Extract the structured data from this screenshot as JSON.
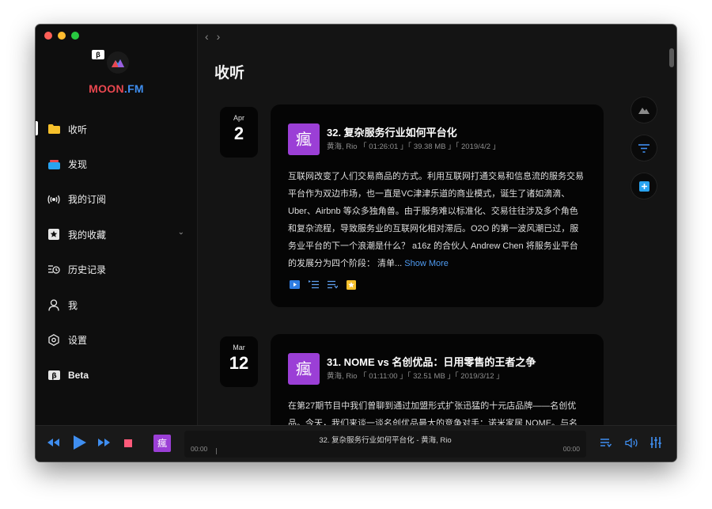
{
  "app": {
    "name_moon": "MOON",
    "name_fm": ".FM",
    "beta_badge": "β",
    "brand_red": "#e8474f",
    "brand_blue": "#3f8ef0"
  },
  "nav": {
    "items": [
      {
        "label": "收听",
        "icon": "folder-icon",
        "active": true
      },
      {
        "label": "发现",
        "icon": "discover-icon"
      },
      {
        "label": "我的订阅",
        "icon": "broadcast-icon"
      },
      {
        "label": "我的收藏",
        "icon": "star-icon"
      },
      {
        "label": "历史记录",
        "icon": "history-icon"
      },
      {
        "label": "我",
        "icon": "user-icon"
      },
      {
        "label": "设置",
        "icon": "settings-icon"
      },
      {
        "label": "Beta",
        "icon": "beta-icon"
      }
    ]
  },
  "main": {
    "title": "收听",
    "episodes": [
      {
        "month": "Apr",
        "day": "2",
        "cover_char": "瘋",
        "title": "32. 复杂服务行业如何平台化",
        "meta": "黄海, Rio 「 01:26:01 」「 39.38 MB 」「 2019/4/2 」",
        "description": "互联网改变了人们交易商品的方式。利用互联网打通交易和信息流的服务交易平台作为双边市场，也一直是VC津津乐道的商业模式，诞生了诸如滴滴、Uber、Airbnb 等众多独角兽。由于服务难以标准化、交易往往涉及多个角色和复杂流程，导致服务业的互联网化相对滞后。O2O 的第一波风潮已过，服务业平台的下一个浪潮是什么？ a16z 的合伙人 Andrew Chen 将服务业平台的发展分为四个阶段： 清单... ",
        "show_more": "Show More"
      },
      {
        "month": "Mar",
        "day": "12",
        "cover_char": "瘋",
        "title": "31. NOME vs 名创优品：日用零售的王者之争",
        "meta": "黄海, Rio 「 01:11:00 」「 32.51 MB 」「 2019/3/12 」",
        "description": "在第27期节目中我们曾聊到通过加盟形式扩张迅猛的十元店品牌——名创优品。今天，我们来谈一谈名创优品最大的竞争对手：诺米家居 NOME。与名"
      }
    ]
  },
  "player": {
    "cover_char": "瘋",
    "now_playing": "32. 复杂服务行业如何平台化 - 黄海, Rio",
    "time_current": "00:00",
    "time_total": "00:00",
    "progress": 0
  }
}
